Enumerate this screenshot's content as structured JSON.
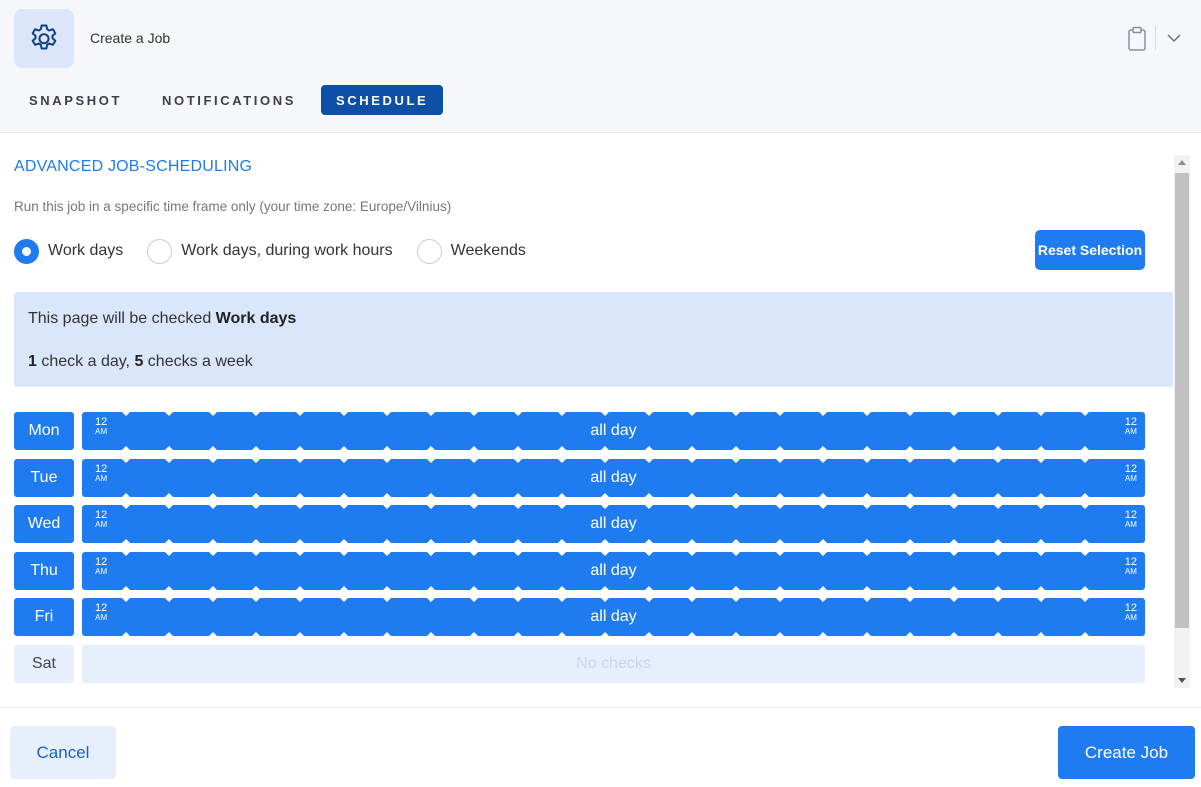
{
  "header": {
    "title": "Create a Job",
    "tabs": [
      {
        "label": "SNAPSHOT",
        "active": false
      },
      {
        "label": "NOTIFICATIONS",
        "active": false
      },
      {
        "label": "SCHEDULE",
        "active": true
      }
    ],
    "icons": {
      "app": "gear-icon",
      "clipboard": "clipboard-icon",
      "dropdown": "chevron-down-icon"
    }
  },
  "schedule": {
    "title": "ADVANCED JOB-SCHEDULING",
    "subtitle": "Run this job in a specific time frame only (your time zone: Europe/Vilnius)",
    "options": [
      {
        "label": "Work days",
        "selected": true
      },
      {
        "label": "Work days, during work hours",
        "selected": false
      },
      {
        "label": "Weekends",
        "selected": false
      }
    ],
    "reset_label": "Reset Selection",
    "info": {
      "line1_prefix": "This page will be checked ",
      "line1_bold": "Work days",
      "per_day": "1",
      "per_day_text": " check a day, ",
      "per_week": "5",
      "per_week_text": " checks a week"
    },
    "time_start": "12",
    "time_start_suffix": "AM",
    "time_end": "12",
    "time_end_suffix": "AM",
    "days": [
      {
        "label": "Mon",
        "active": true,
        "bar_text": "all day"
      },
      {
        "label": "Tue",
        "active": true,
        "bar_text": "all day"
      },
      {
        "label": "Wed",
        "active": true,
        "bar_text": "all day"
      },
      {
        "label": "Thu",
        "active": true,
        "bar_text": "all day"
      },
      {
        "label": "Fri",
        "active": true,
        "bar_text": "all day"
      },
      {
        "label": "Sat",
        "active": false,
        "bar_text": "No checks"
      }
    ]
  },
  "footer": {
    "cancel_label": "Cancel",
    "create_label": "Create Job"
  },
  "colors": {
    "accent": "#1f7cf0",
    "tab_active": "#0e4fa8",
    "info_bg": "#dae6fb",
    "inactive_bg": "#e8effc"
  }
}
